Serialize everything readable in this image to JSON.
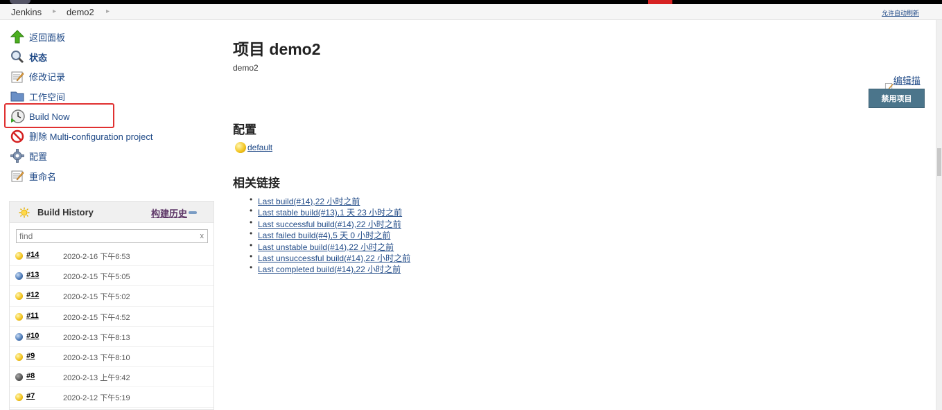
{
  "breadcrumbs": {
    "items": [
      "Jenkins",
      "demo2"
    ],
    "auto_refresh": "允许自动刷新"
  },
  "sidebar": {
    "tasks": [
      {
        "label": "返回面板",
        "icon": "up-arrow-icon"
      },
      {
        "label": "状态",
        "icon": "search-icon"
      },
      {
        "label": "修改记录",
        "icon": "notepad-icon"
      },
      {
        "label": "工作空间",
        "icon": "folder-icon"
      },
      {
        "label": "Build Now",
        "icon": "clock-icon"
      },
      {
        "label": "删除 Multi-configuration project",
        "icon": "no-entry-icon"
      },
      {
        "label": "配置",
        "icon": "gear-icon"
      },
      {
        "label": "重命名",
        "icon": "notepad-icon"
      }
    ]
  },
  "build_history": {
    "title": "Build History",
    "trend_label": "构建历史",
    "search_placeholder": "find",
    "clear_label": "x",
    "builds": [
      {
        "num": "#14",
        "date": "2020-2-16 下午6:53",
        "status": "yellow"
      },
      {
        "num": "#13",
        "date": "2020-2-15 下午5:05",
        "status": "blue"
      },
      {
        "num": "#12",
        "date": "2020-2-15 下午5:02",
        "status": "yellow"
      },
      {
        "num": "#11",
        "date": "2020-2-15 下午4:52",
        "status": "yellow"
      },
      {
        "num": "#10",
        "date": "2020-2-13 下午8:13",
        "status": "blue"
      },
      {
        "num": "#9",
        "date": "2020-2-13 下午8:10",
        "status": "yellow"
      },
      {
        "num": "#8",
        "date": "2020-2-13 上午9:42",
        "status": "grey"
      },
      {
        "num": "#7",
        "date": "2020-2-12 下午5:19",
        "status": "yellow"
      }
    ]
  },
  "main": {
    "title": "项目 demo2",
    "description": "demo2",
    "edit_description": "编辑描述",
    "disable_button": "禁用项目",
    "config_heading": "配置",
    "config_items": [
      {
        "label": "default",
        "status": "yellow"
      }
    ],
    "links_heading": "相关链接",
    "links": [
      "Last build(#14),22 小时之前",
      "Last stable build(#13),1 天 23 小时之前",
      "Last successful build(#14),22 小时之前",
      "Last failed build(#4),5 天 0 小时之前",
      "Last unstable build(#14),22 小时之前",
      "Last unsuccessful build(#14),22 小时之前",
      "Last completed build(#14),22 小时之前"
    ]
  },
  "colors": {
    "link": "#204a87",
    "highlight": "#e03030",
    "button": "#4b758b"
  }
}
